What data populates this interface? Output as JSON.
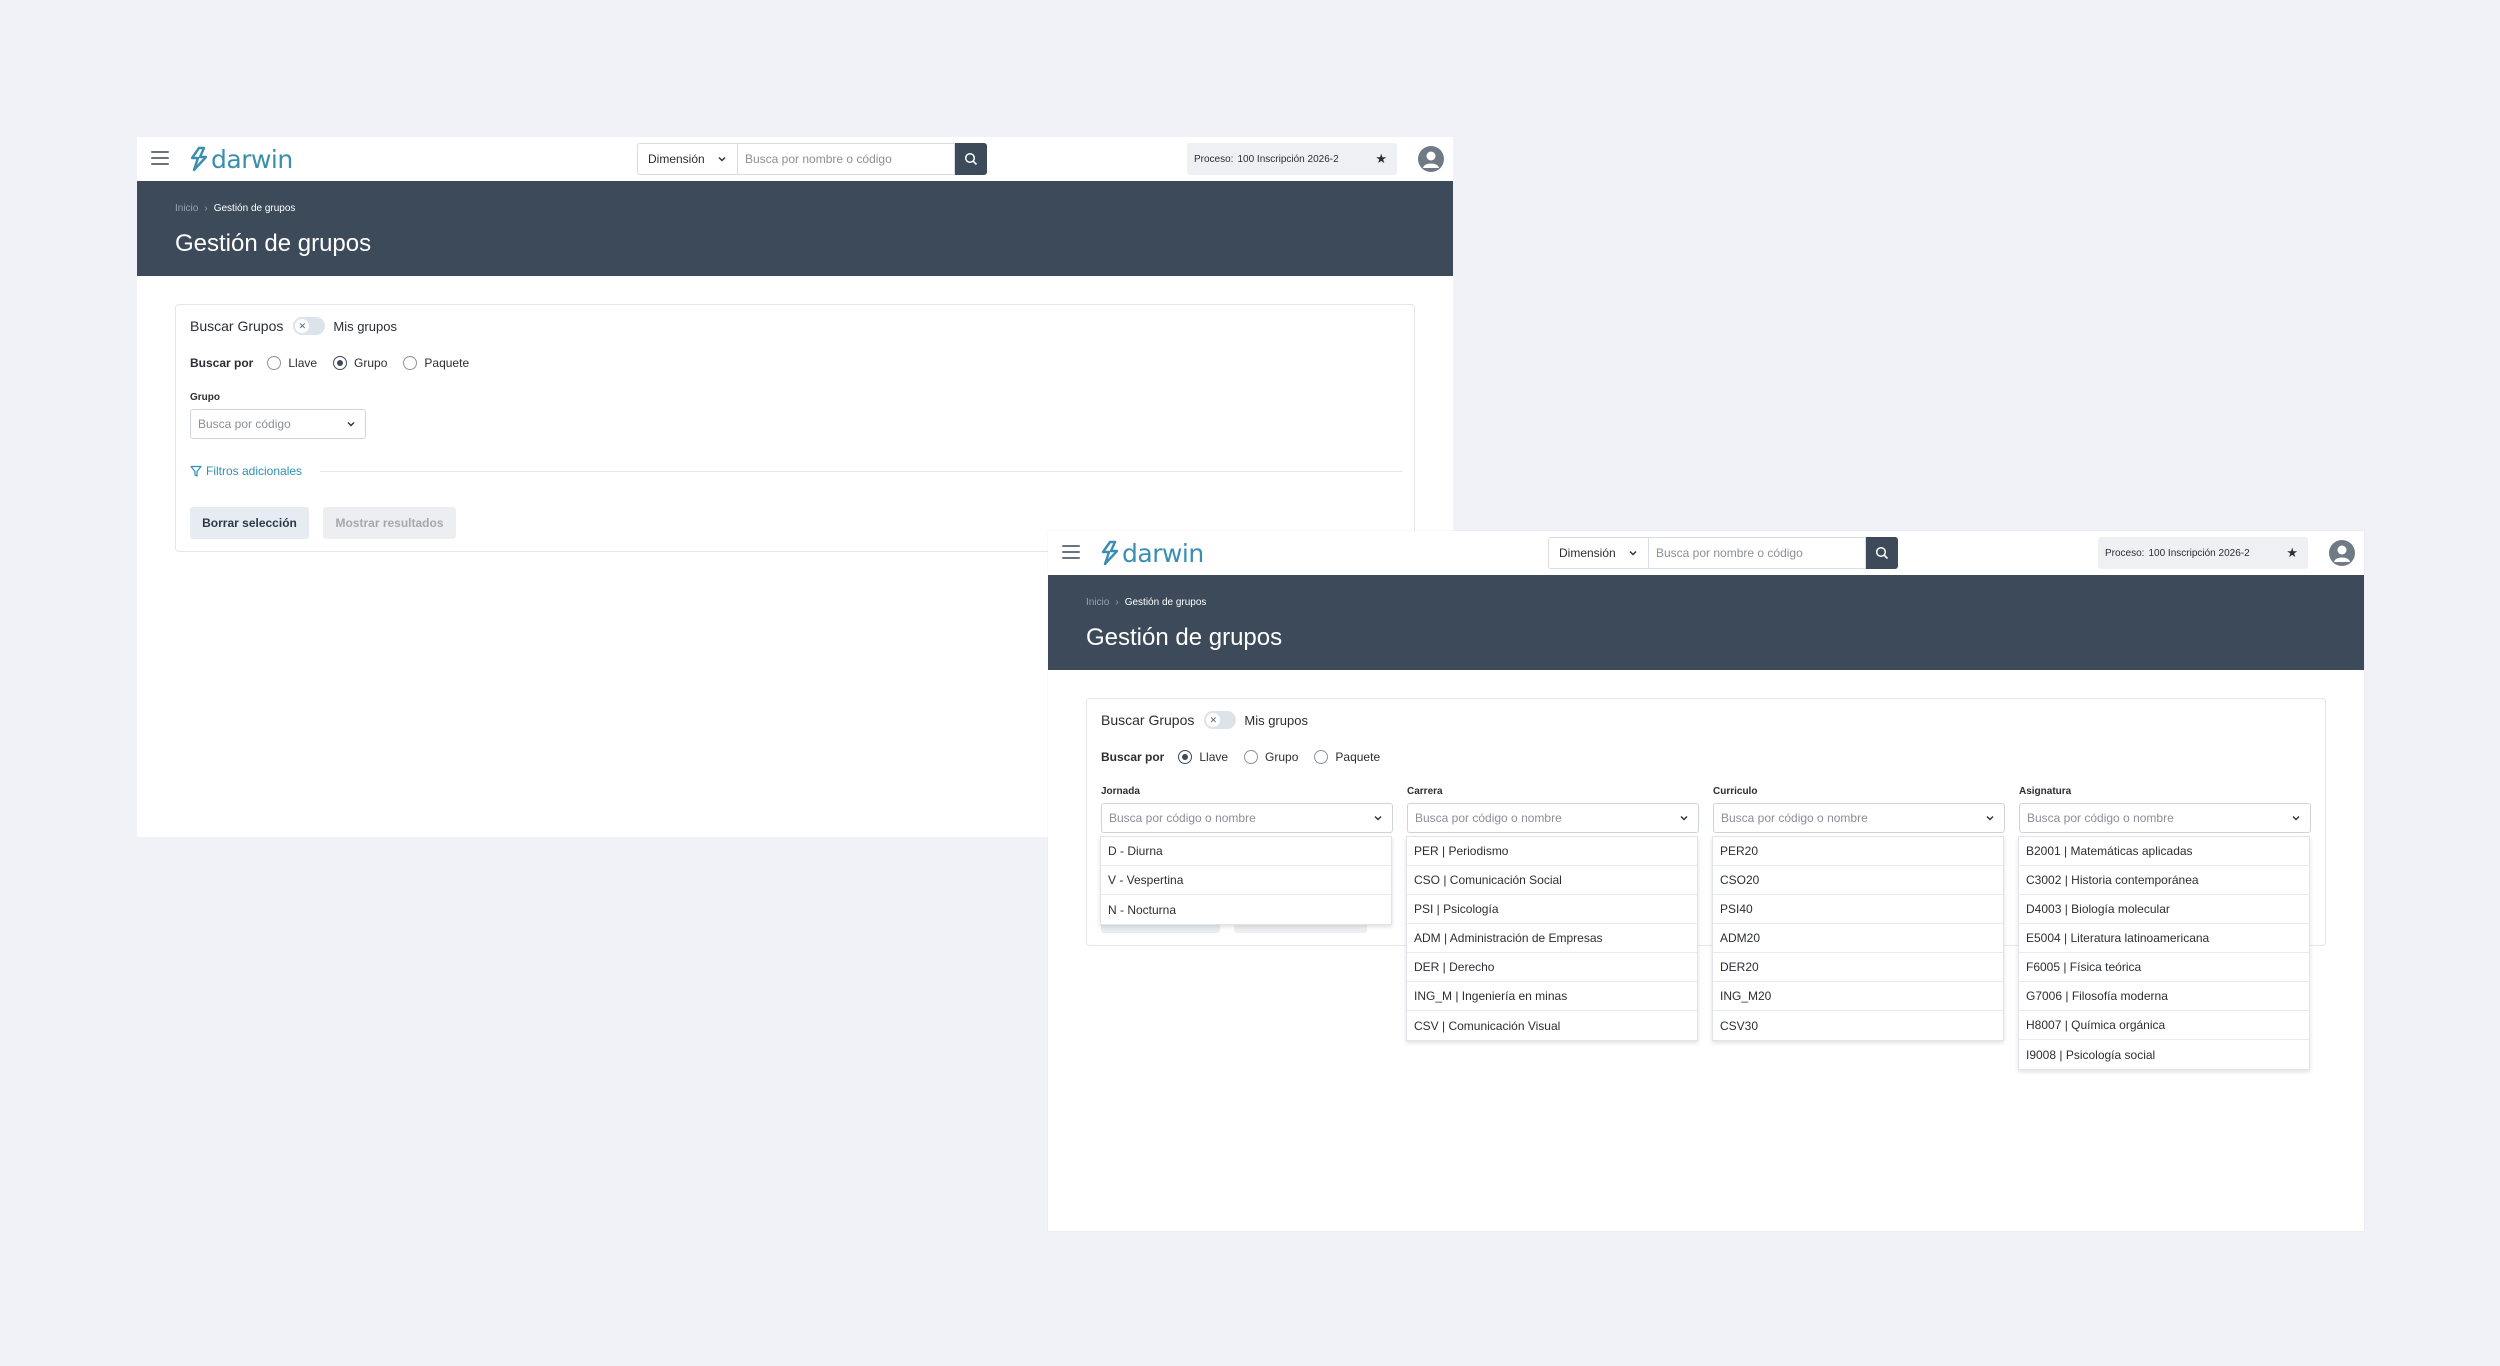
{
  "app": {
    "logo_text": "darwin",
    "dimension_label": "Dimensión",
    "search_placeholder": "Busca por nombre o código",
    "process_label": "Proceso:",
    "process_value": "100 Inscripción 2026-2"
  },
  "breadcrumb": {
    "home": "Inicio",
    "sep": "›",
    "current": "Gestión de grupos"
  },
  "page_title": "Gestión de grupos",
  "card": {
    "title": "Buscar Grupos",
    "toggle_label": "Mis grupos",
    "toggle_knob": "✕",
    "search_by_label": "Buscar por",
    "options": [
      "Llave",
      "Grupo",
      "Paquete"
    ]
  },
  "frame_a": {
    "selected_option": "Grupo",
    "group_label": "Grupo",
    "group_placeholder": "Busca por código",
    "filters_link": "Filtros adicionales",
    "clear_button": "Borrar selección",
    "show_button": "Mostrar resultados"
  },
  "frame_b": {
    "selected_option": "Llave",
    "fields": [
      {
        "label": "Jornada",
        "placeholder": "Busca por código o nombre",
        "options": [
          "D - Diurna",
          "V - Vespertina",
          "N - Nocturna"
        ]
      },
      {
        "label": "Carrera",
        "placeholder": "Busca por código o nombre",
        "options": [
          "PER | Periodismo",
          "CSO | Comunicación Social",
          "PSI | Psicología",
          "ADM | Administración de Empresas",
          "DER | Derecho",
          "ING_M | Ingeniería en minas",
          "CSV | Comunicación Visual"
        ]
      },
      {
        "label": "Curriculo",
        "placeholder": "Busca por código o nombre",
        "options": [
          "PER20",
          "CSO20",
          "PSI40",
          "ADM20",
          "DER20",
          "ING_M20",
          "CSV30"
        ]
      },
      {
        "label": "Asignatura",
        "placeholder": "Busca por código o nombre",
        "options": [
          "B2001 | Matemáticas aplicadas",
          "C3002 | Historia contemporánea",
          "D4003 | Biología molecular",
          "E5004 | Literatura latinoamericana",
          "F6005 | Física teórica",
          "G7006 | Filosofía moderna",
          "H8007 | Química orgánica",
          "I9008 | Psicología social"
        ]
      }
    ]
  },
  "colors": {
    "header": "#3c4a5a",
    "accent": "#2f8fb8",
    "logo": "#3a8fb0"
  },
  "icons": {
    "menu": "hamburger-icon",
    "search": "search-icon",
    "star": "star-icon",
    "user": "user-icon",
    "filter": "filter-icon",
    "chevron": "chevron-down-icon"
  }
}
